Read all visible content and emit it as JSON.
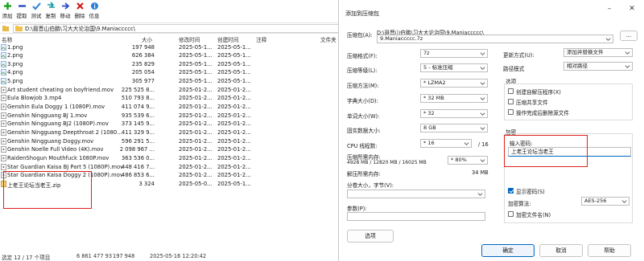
{
  "toolbar": [
    {
      "label": "添加",
      "icon": "add-icon",
      "color": "#1aa31a"
    },
    {
      "label": "提取",
      "icon": "extract-icon",
      "color": "#2b4bc8"
    },
    {
      "label": "测试",
      "icon": "test-icon",
      "color": "#2b7fd6"
    },
    {
      "label": "复制",
      "icon": "copy-icon",
      "color": "#1a9aa8"
    },
    {
      "label": "移动",
      "icon": "move-icon",
      "color": "#2b4bc8"
    },
    {
      "label": "删除",
      "icon": "delete-icon",
      "color": "#d21d1d"
    },
    {
      "label": "信息",
      "icon": "info-icon",
      "color": "#2b7fd6"
    }
  ],
  "address": {
    "path": "D:\\聂晋山伯鹏\\习大大论治国\\9.Maniaccccc\\"
  },
  "columns": {
    "name": "名称",
    "size": "大小",
    "modified": "修改时间",
    "created": "创建时间",
    "comment": "注释",
    "folders": "文件夹"
  },
  "files": [
    {
      "name": "1.png",
      "size": "197 948",
      "modified": "2025-05-1...",
      "created": "2025-05-1...",
      "type": "image"
    },
    {
      "name": "2.png",
      "size": "626 384",
      "modified": "2025-05-1...",
      "created": "2025-05-1...",
      "type": "image"
    },
    {
      "name": "3.png",
      "size": "235 829",
      "modified": "2025-05-1...",
      "created": "2025-05-1...",
      "type": "image"
    },
    {
      "name": "4.png",
      "size": "205 054",
      "modified": "2025-05-1...",
      "created": "2025-05-1...",
      "type": "image"
    },
    {
      "name": "5.png",
      "size": "305 977",
      "modified": "2025-05-1...",
      "created": "2025-05-1...",
      "type": "image"
    },
    {
      "name": "Art student cheating on boyfriend.mov",
      "size": "225 525 8...",
      "modified": "2025-01-2...",
      "created": "2025-01-2...",
      "type": "video"
    },
    {
      "name": "Eula Blowjob 3.mp4",
      "size": "510 793 8...",
      "modified": "2025-01-2...",
      "created": "2025-01-2...",
      "type": "video"
    },
    {
      "name": "Genshin Eula Doggy 1 (1080P).mov",
      "size": "411 074 9...",
      "modified": "2025-01-2...",
      "created": "2025-01-2...",
      "type": "video"
    },
    {
      "name": "Genshin Ningguang BJ 1.mov",
      "size": "935 539 6...",
      "modified": "2025-01-2...",
      "created": "2025-01-2...",
      "type": "video"
    },
    {
      "name": "Genshin Ningguang BJ2 (1080P).mov",
      "size": "373 145 9...",
      "modified": "2025-01-2...",
      "created": "2025-01-2...",
      "type": "video"
    },
    {
      "name": "Genshin Ningguang Deepthroat 2 (1080...",
      "size": "411 329 9...",
      "modified": "2025-01-2...",
      "created": "2025-01-2...",
      "type": "video"
    },
    {
      "name": "Genshin Ningguang Doggy.mov",
      "size": "596 291 5...",
      "modified": "2025-01-2...",
      "created": "2025-01-2...",
      "type": "video"
    },
    {
      "name": "Genshin Noelle Full Video (4K).mov",
      "size": "2 098 967 ...",
      "modified": "2025-01-2...",
      "created": "2025-01-2...",
      "type": "video"
    },
    {
      "name": "RaidenShogun Mouthfuck 1080P.mov",
      "size": "363 536 0...",
      "modified": "2025-01-2...",
      "created": "2025-01-2...",
      "type": "video"
    },
    {
      "name": "Star Guardian Kaisa BJ Part 5 (1080P).mov",
      "size": "448 416 7...",
      "modified": "2025-01-2...",
      "created": "2025-01-2...",
      "type": "video"
    },
    {
      "name": "Star Guardian Kaisa Doggy 2 (1080P).mov",
      "size": "486 853 6...",
      "modified": "2025-01-2...",
      "created": "2025-01-2...",
      "type": "video"
    },
    {
      "name": "上老王论坛当老王.zip",
      "size": "3 324",
      "modified": "2025-05-0...",
      "created": "2025-05-1...",
      "type": "zip"
    }
  ],
  "status": {
    "selection": "选定 12 / 17 个项目",
    "total": "6 861 477 93",
    "selected_size": "197 948",
    "datetime": "2025-05-16 12:20:42"
  },
  "dialog": {
    "title": "添加到压缩包",
    "archive_label": "压缩包(A):",
    "archive_dir": "D:\\聂晋山伯鹏\\习大大论治国\\9.Maniaccccc\\",
    "archive_name": "9.Maniaccccc.7z",
    "browse": "...",
    "format_label": "压缩格式(F):",
    "format_value": "7z",
    "level_label": "压缩等级(L):",
    "level_value": "5 - 标准压缩",
    "method_label": "压缩方法(M):",
    "method_value": "* LZMA2",
    "dict_label": "字典大小(D):",
    "dict_value": "* 32 MB",
    "word_label": "单词大小(W):",
    "word_value": "* 32",
    "solid_label": "固实数据大小:",
    "solid_value": "8 GB",
    "cpu_label": "CPU 线程数:",
    "cpu_value": "* 16",
    "cpu_total": "/ 16",
    "mem_label": "压缩所需内存:",
    "mem_detail": "4928 MB / 12820 MB / 16025 MB",
    "mem_value": "* 80%",
    "decomp_label": "解压所需内存:",
    "decomp_value": "34 MB",
    "split_label": "分卷大小，字节(V):",
    "params_label": "参数(P):",
    "options_button": "选项",
    "update_label": "更新方式(U):",
    "update_value": "添加并替换文件",
    "path_label": "路径模式",
    "path_value": "相对路径",
    "options_group": "选项",
    "opt_sfx": "创建自解压程序(X)",
    "opt_shared": "压缩共享文件",
    "opt_delete": "操作完成后删除源文件",
    "encrypt_group": "加密",
    "password_label": "输入密码:",
    "password_value": "上老王论坛当老王",
    "show_password": "显示密码(S)",
    "enc_method_label": "加密算法:",
    "enc_method_value": "AES-256",
    "encrypt_names": "加密文件名(N)",
    "ok": "确定",
    "cancel": "取消",
    "help": "帮助"
  }
}
